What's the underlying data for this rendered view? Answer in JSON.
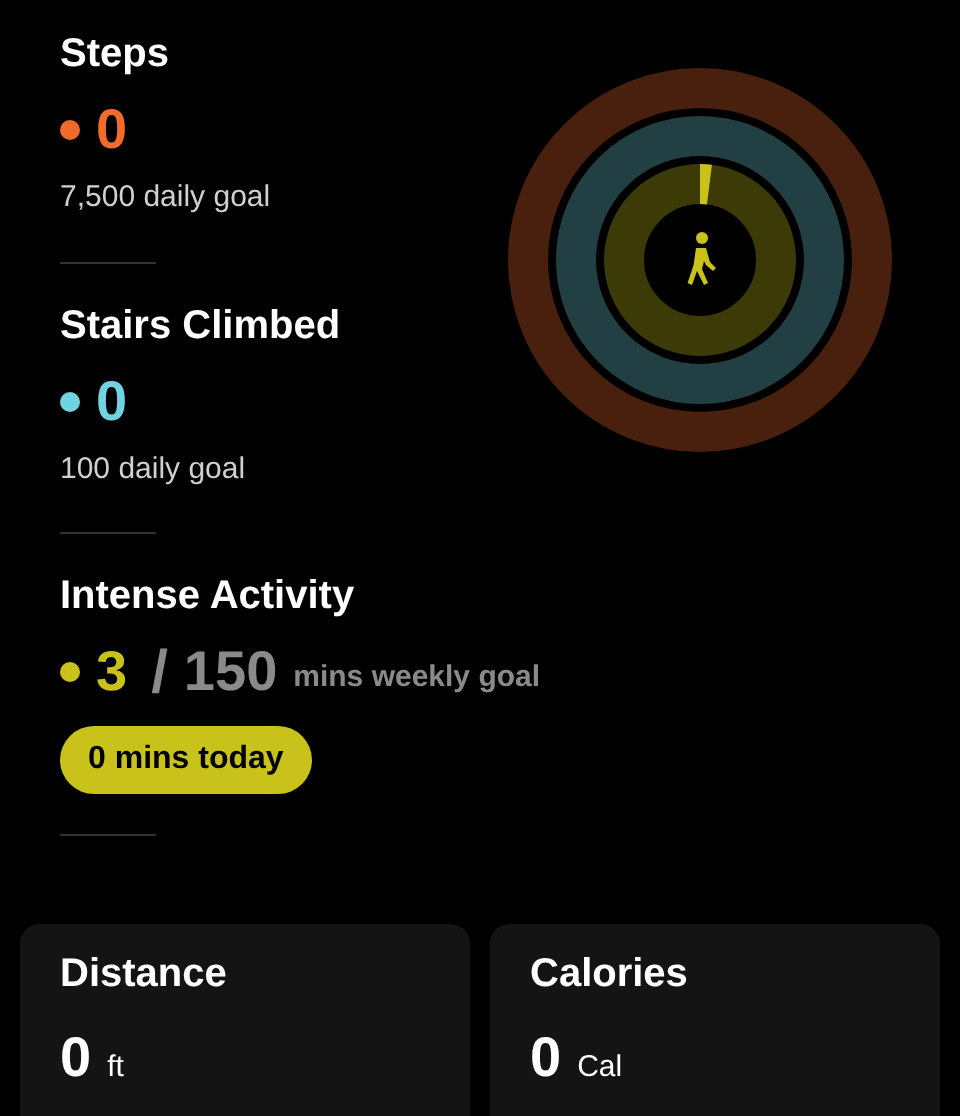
{
  "metrics": [
    {
      "kind": "daily",
      "title": "Steps",
      "color": "#f26b2a",
      "value": "0",
      "goal": "7,500 daily goal"
    },
    {
      "kind": "daily",
      "title": "Stairs Climbed",
      "color": "#6fd3e0",
      "value": "0",
      "goal": "100 daily goal"
    },
    {
      "kind": "weekly",
      "title": "Intense Activity",
      "color": "#c8c21a",
      "value": "3",
      "separator": "/",
      "target": "150",
      "unit": "mins weekly goal",
      "badge": "0 mins today"
    }
  ],
  "cards": [
    {
      "title": "Distance",
      "value": "0",
      "unit": "ft"
    },
    {
      "title": "Calories",
      "value": "0",
      "unit": "Cal"
    }
  ]
}
